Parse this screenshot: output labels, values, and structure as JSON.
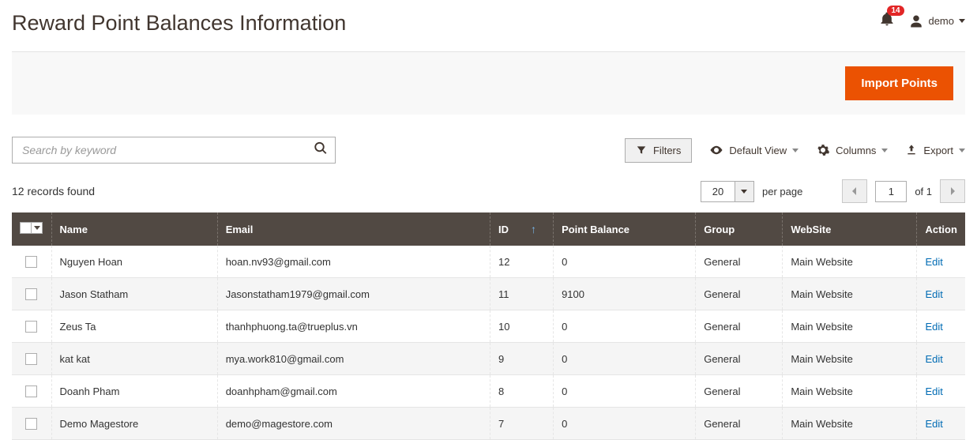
{
  "header": {
    "title": "Reward Point Balances Information",
    "notification_count": "14",
    "user_name": "demo"
  },
  "actions": {
    "import_label": "Import Points"
  },
  "toolbar": {
    "search_placeholder": "Search by keyword",
    "filters_label": "Filters",
    "default_view_label": "Default View",
    "columns_label": "Columns",
    "export_label": "Export"
  },
  "records": {
    "found_text": "12 records found",
    "page_size": "20",
    "per_page_label": "per page",
    "current_page": "1",
    "total_pages_label": "of 1"
  },
  "columns": {
    "name": "Name",
    "email": "Email",
    "id": "ID",
    "point_balance": "Point Balance",
    "group": "Group",
    "website": "WebSite",
    "action": "Action"
  },
  "rows": [
    {
      "name": "Nguyen Hoan",
      "email": "hoan.nv93@gmail.com",
      "id": "12",
      "balance": "0",
      "group": "General",
      "website": "Main Website",
      "action": "Edit"
    },
    {
      "name": "Jason Statham",
      "email": "Jasonstatham1979@gmail.com",
      "id": "11",
      "balance": "9100",
      "group": "General",
      "website": "Main Website",
      "action": "Edit"
    },
    {
      "name": "Zeus Ta",
      "email": "thanhphuong.ta@trueplus.vn",
      "id": "10",
      "balance": "0",
      "group": "General",
      "website": "Main Website",
      "action": "Edit"
    },
    {
      "name": "kat kat",
      "email": "mya.work810@gmail.com",
      "id": "9",
      "balance": "0",
      "group": "General",
      "website": "Main Website",
      "action": "Edit"
    },
    {
      "name": "Doanh Pham",
      "email": "doanhpham@gmail.com",
      "id": "8",
      "balance": "0",
      "group": "General",
      "website": "Main Website",
      "action": "Edit"
    },
    {
      "name": "Demo Magestore",
      "email": "demo@magestore.com",
      "id": "7",
      "balance": "0",
      "group": "General",
      "website": "Main Website",
      "action": "Edit"
    }
  ]
}
